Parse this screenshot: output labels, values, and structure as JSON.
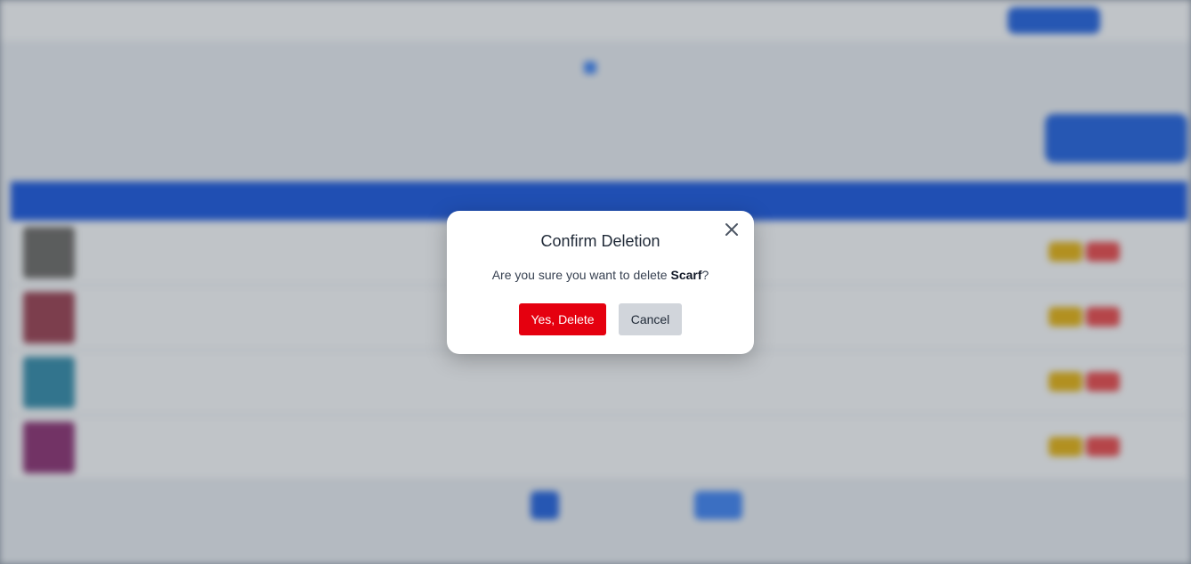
{
  "colors": {
    "primary": "#1453e0",
    "danger": "#e5000f",
    "warning": "#eab308",
    "cancel_bg": "#d1d5db"
  },
  "modal": {
    "title": "Confirm Deletion",
    "message_prefix": "Are you sure you want to delete ",
    "item_name": "Scarf",
    "message_suffix": "?",
    "confirm_label": "Yes, Delete",
    "cancel_label": "Cancel",
    "close_icon": "close-icon"
  },
  "background": {
    "blurred": true
  }
}
